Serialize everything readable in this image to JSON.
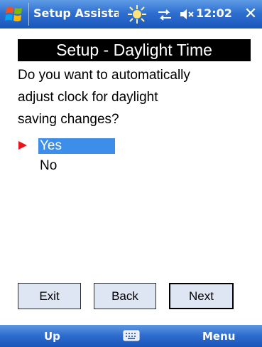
{
  "titlebar": {
    "title": "Setup Assistant",
    "clock": "12:02",
    "close_label": "✕",
    "icons": [
      "windows-start-icon",
      "daylight-sun-icon",
      "connectivity-icon",
      "volume-muted-icon"
    ]
  },
  "content": {
    "heading": "Setup - Daylight Time",
    "question_lines": [
      "Do you want to automatically",
      "adjust clock for daylight",
      "saving changes?"
    ],
    "options": [
      {
        "label": "Yes",
        "selected": true
      },
      {
        "label": "No",
        "selected": false
      }
    ]
  },
  "buttons": {
    "exit": "Exit",
    "back": "Back",
    "next": "Next"
  },
  "menubar": {
    "left": "Up",
    "right": "Menu",
    "center_icon": "keyboard-icon"
  },
  "colors": {
    "titlebar": "#2f6fd0",
    "selection": "#3d8ee8",
    "marker": "#e8151b",
    "button_face": "#dde6f2"
  }
}
